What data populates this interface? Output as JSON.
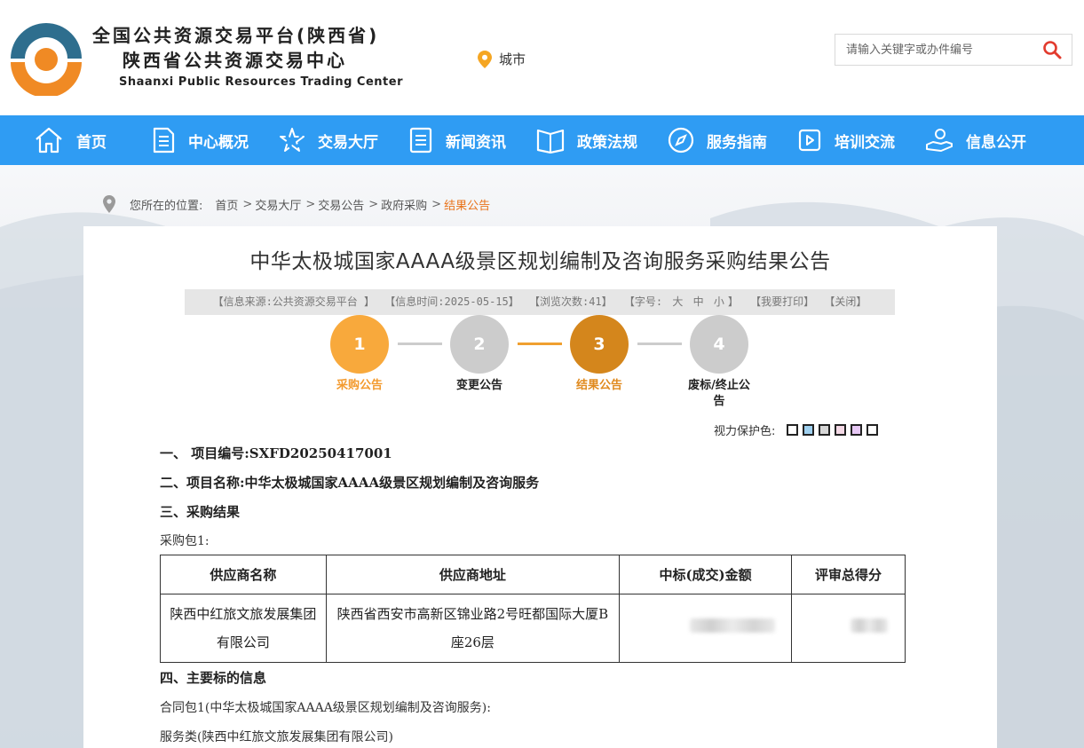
{
  "header": {
    "title_line1": "全国公共资源交易平台(陕西省)",
    "title_line2": "陕西省公共资源交易中心",
    "title_en": "Shaanxi Public Resources Trading Center",
    "city_label": "城市",
    "search_placeholder": "请输入关键字或办件编号"
  },
  "nav": [
    {
      "label": "首页",
      "icon": "home-icon"
    },
    {
      "label": "中心概况",
      "icon": "document-icon"
    },
    {
      "label": "交易大厅",
      "icon": "star-icon"
    },
    {
      "label": "新闻资讯",
      "icon": "news-icon"
    },
    {
      "label": "政策法规",
      "icon": "book-icon"
    },
    {
      "label": "服务指南",
      "icon": "compass-icon"
    },
    {
      "label": "培训交流",
      "icon": "video-icon"
    },
    {
      "label": "信息公开",
      "icon": "hand-icon"
    }
  ],
  "breadcrumb": {
    "prefix": "您所在的位置:",
    "items": [
      "首页",
      "交易大厅",
      "交易公告",
      "政府采购"
    ],
    "current": "结果公告"
  },
  "notice": {
    "title": "中华太极城国家AAAA级景区规划编制及咨询服务采购结果公告",
    "info": {
      "source": "【信息来源:公共资源交易平台 】",
      "time": "【信息时间:2025-05-15】",
      "views": "【浏览次数:41】",
      "font_prefix": "【字号:",
      "font_big": "大",
      "font_mid": "中",
      "font_small": "小",
      "font_suffix": "】",
      "print": "【我要打印】",
      "close": "【关闭】"
    },
    "steps": [
      {
        "num": "1",
        "label": "采购公告",
        "color": "#f8a93c",
        "label_color": "#f39a2d"
      },
      {
        "num": "2",
        "label": "变更公告",
        "color": "#cccccc",
        "label_color": "#222222"
      },
      {
        "num": "3",
        "label": "结果公告",
        "color": "#d4861c",
        "label_color": "#e08a1e"
      },
      {
        "num": "4",
        "label": "废标/终止公告",
        "color": "#cccccc",
        "label_color": "#222222"
      }
    ],
    "eye_label": "视力保护色:",
    "eye_colors": [
      "#ffffff",
      "#9fd0ef",
      "#d6d6d6",
      "#f4d9e6",
      "#e7c8f5",
      "#ffffff"
    ],
    "sec1": "一、  项目编号:SXFD20250417001",
    "sec2": "二、项目名称:中华太极城国家AAAA级景区规划编制及咨询服务",
    "sec3": "三、采购结果",
    "pkg": "采购包1:",
    "table": {
      "headers": [
        "供应商名称",
        "供应商地址",
        "中标(成交)金额",
        "评审总得分"
      ],
      "rows": [
        {
          "name": "陕西中红旅文旅发展集团有限公司",
          "address": "陕西省西安市高新区锦业路2号旺都国际大厦B座26层"
        }
      ]
    },
    "sec4": "四、主要标的信息",
    "contract": "合同包1(中华太极城国家AAAA级景区规划编制及咨询服务):",
    "service": "服务类(陕西中红旅文旅发展集团有限公司)"
  }
}
